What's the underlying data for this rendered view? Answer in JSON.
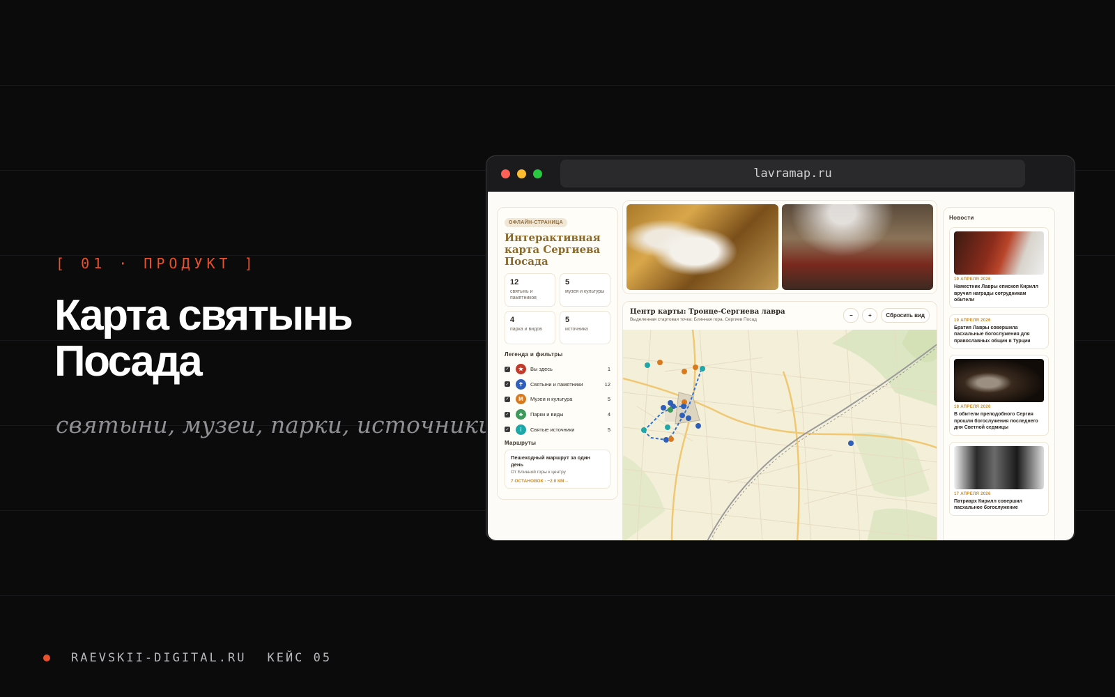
{
  "hero": {
    "tag": "[ 01 · ПРОДУКТ ]",
    "title": "Карта святынь Посада",
    "subtitle": "святыни, музеи, парки, источники"
  },
  "footer": {
    "site": "RAEVSKII-DIGITAL.RU",
    "case": "КЕЙС 05"
  },
  "browser": {
    "url": "lavramap.ru"
  },
  "sidebar": {
    "badge": "ОФЛАЙН-СТРАНИЦА",
    "title": "Интерактивная карта Сергиева Посада",
    "stats": [
      {
        "value": "12",
        "label": "святынь и памятников"
      },
      {
        "value": "5",
        "label": "музея и культуры"
      },
      {
        "value": "4",
        "label": "парка и видов"
      },
      {
        "value": "5",
        "label": "источника"
      }
    ],
    "legend_heading": "Легенда и фильтры",
    "legend": [
      {
        "label": "Вы здесь",
        "count": "1",
        "color": "#c0392b",
        "icon": "star-icon",
        "glyph": "★"
      },
      {
        "label": "Святыни и памятники",
        "count": "12",
        "color": "#2f5fb8",
        "icon": "cross-icon",
        "glyph": "✝"
      },
      {
        "label": "Музеи и культура",
        "count": "5",
        "color": "#d9791e",
        "icon": "museum-icon",
        "glyph": "M"
      },
      {
        "label": "Парки и виды",
        "count": "4",
        "color": "#3d9a5a",
        "icon": "tree-icon",
        "glyph": "♣"
      },
      {
        "label": "Святые источники",
        "count": "5",
        "color": "#1fa6a6",
        "icon": "info-icon",
        "glyph": "i"
      }
    ],
    "routes_heading": "Маршруты",
    "route": {
      "title": "Пешеходный маршрут за один день",
      "subtitle": "От Блинной горы к центру",
      "meta": "7 ОСТАНОВОК · ~2.0 КМ→"
    }
  },
  "map": {
    "title": "Центр карты: Троице-Сергиева лавра",
    "subtitle": "Выделенная стартовая точка: Блинная гора, Сергиев Посад",
    "zoom_out": "−",
    "zoom_in": "+",
    "reset": "Сбросить вид"
  },
  "news": {
    "heading": "Новости",
    "items": [
      {
        "date": "19 АПРЕЛЯ 2026",
        "title": "Наместник Лавры епископ Кирилл вручил награды сотрудникам обители",
        "has_image": true
      },
      {
        "date": "19 АПРЕЛЯ 2026",
        "title": "Братия Лавры совершила пасхальные богослужения для православных общин в Турции",
        "has_image": false
      },
      {
        "date": "18 АПРЕЛЯ 2026",
        "title": "В обители преподобного Сергия прошли богослужения последнего дня Светлой седмицы",
        "has_image": true
      },
      {
        "date": "17 АПРЕЛЯ 2026",
        "title": "Патриарх Кирилл совершил пасхальное богослужение",
        "has_image": true
      }
    ]
  }
}
